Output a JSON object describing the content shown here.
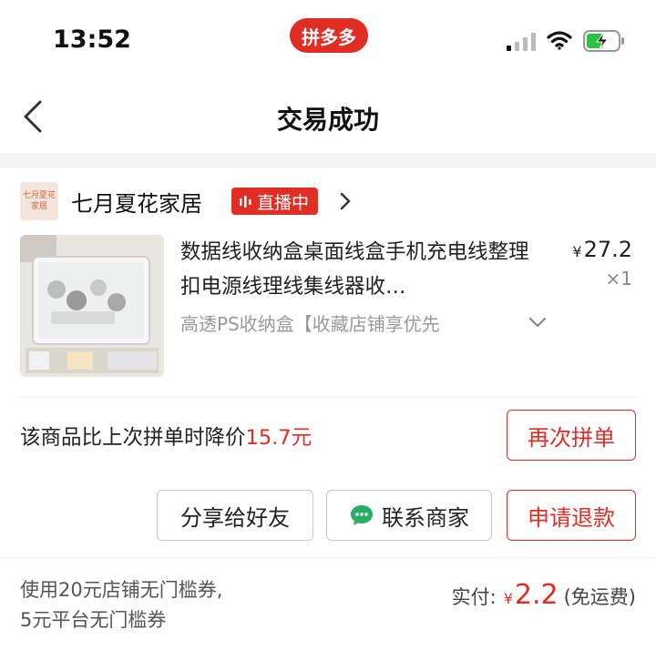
{
  "status_bar": {
    "time": "13:52",
    "logo_text": "拼多多"
  },
  "nav": {
    "title": "交易成功"
  },
  "store": {
    "logo_text_line1": "七月夏花",
    "logo_text_line2": "家居",
    "name": "七月夏花家居",
    "live_label": "直播中"
  },
  "product": {
    "title": "数据线收纳盒桌面线盒手机充电线整理扣电源线理线集线器收…",
    "price_symbol": "¥",
    "price": "27.2",
    "quantity": "×1",
    "spec": "高透PS收纳盒【收藏店铺享优先"
  },
  "price_drop": {
    "text": "该商品比上次拼单时降价",
    "amount": "15.7元"
  },
  "buttons": {
    "reorder": "再次拼单",
    "share": "分享给好友",
    "contact": "联系商家",
    "refund": "申请退款"
  },
  "footer": {
    "coupon_line1": "使用20元店铺无门槛券,",
    "coupon_line2": "5元平台无门槛券",
    "paid_label": "实付:",
    "paid_symbol": "¥",
    "paid_amount": "2.2",
    "shipping_note": "(免运费)"
  },
  "colors": {
    "accent": "#e02e24",
    "chat_green": "#2aae67"
  }
}
